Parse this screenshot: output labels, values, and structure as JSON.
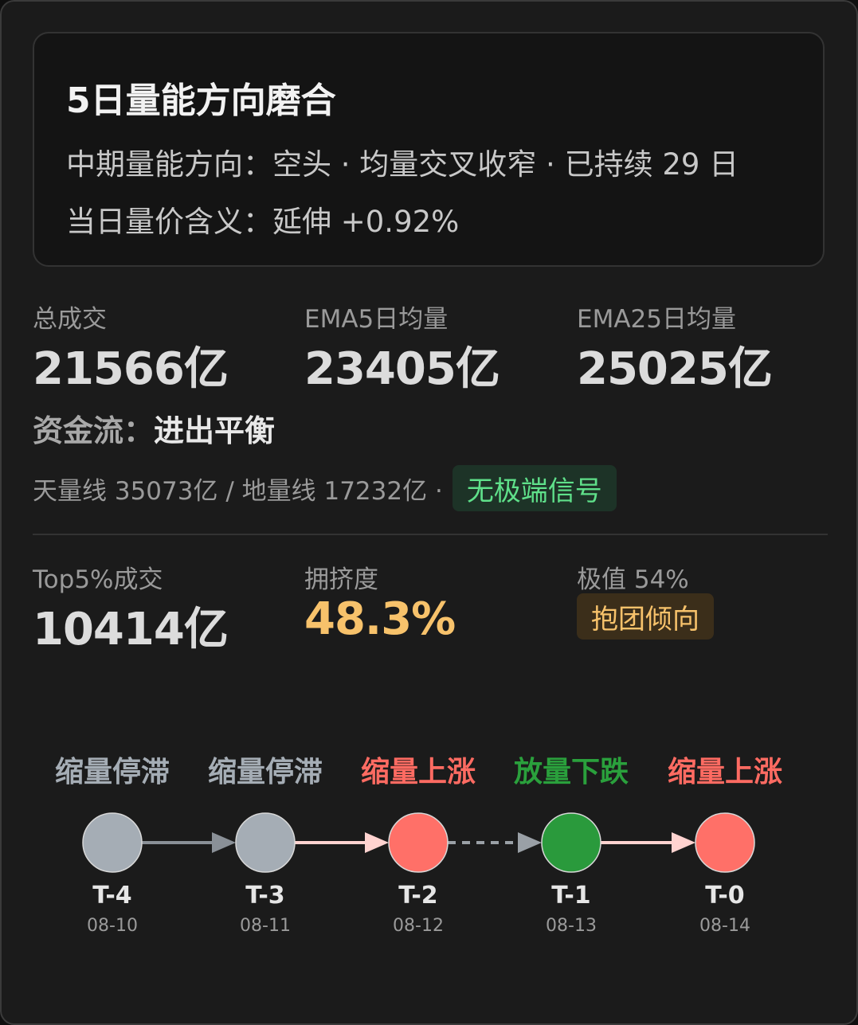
{
  "header": {
    "title": "5日量能方向磨合",
    "line1": "中期量能方向：空头 · 均量交叉收窄 · 已持续 29 日",
    "line2": "当日量价含义：延伸 +0.92%"
  },
  "stats": [
    {
      "label": "总成交",
      "value": "21566亿"
    },
    {
      "label": "EMA5日均量",
      "value": "23405亿"
    },
    {
      "label": "EMA25日均量",
      "value": "25025亿"
    }
  ],
  "flow": {
    "label": "资金流：",
    "value": "进出平衡"
  },
  "volume_lines": {
    "text": "天量线 35073亿 / 地量线 17232亿 ·",
    "badge": "无极端信号",
    "badge_color": "#5fe08a"
  },
  "concentration": {
    "top5_label": "Top5%成交",
    "top5_value": "10414亿",
    "crowd_label": "拥挤度",
    "crowd_value": "48.3%",
    "crowd_color": "#f7c26b",
    "peak_label": "极值 54%",
    "tendency_badge": "抱团倾向"
  },
  "timeline": {
    "days": [
      {
        "state": "缩量停滞",
        "t": "T-4",
        "date": "08-10",
        "color": "#a5adb5",
        "state_color": "#a5adb5"
      },
      {
        "state": "缩量停滞",
        "t": "T-3",
        "date": "08-11",
        "color": "#a5adb5",
        "state_color": "#a5adb5"
      },
      {
        "state": "缩量上涨",
        "t": "T-2",
        "date": "08-12",
        "color": "#ff7068",
        "state_color": "#ff6b62"
      },
      {
        "state": "放量下跌",
        "t": "T-1",
        "date": "08-13",
        "color": "#2a9a3c",
        "state_color": "#2aa03c"
      },
      {
        "state": "缩量上涨",
        "t": "T-0",
        "date": "08-14",
        "color": "#ff7068",
        "state_color": "#ff6b62"
      }
    ],
    "connectors": [
      {
        "style": "solid",
        "color": "#8a9097"
      },
      {
        "style": "solid",
        "color": "#ffd3d0"
      },
      {
        "style": "dashed",
        "color": "#9aa0a6"
      },
      {
        "style": "solid",
        "color": "#ffd3d0"
      }
    ]
  }
}
